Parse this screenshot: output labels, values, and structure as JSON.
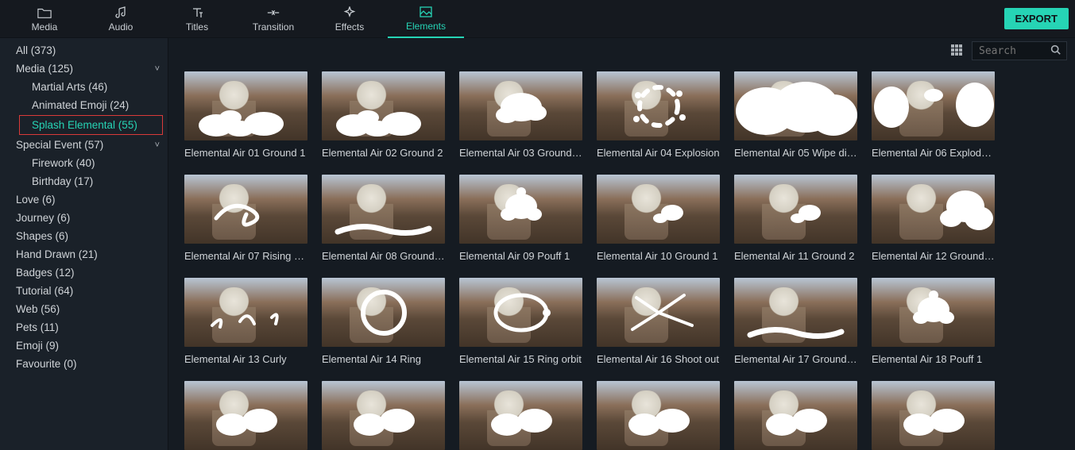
{
  "topbar": {
    "tabs": [
      {
        "label": "Media",
        "icon": "folder"
      },
      {
        "label": "Audio",
        "icon": "music"
      },
      {
        "label": "Titles",
        "icon": "text"
      },
      {
        "label": "Transition",
        "icon": "transition"
      },
      {
        "label": "Effects",
        "icon": "sparkle"
      },
      {
        "label": "Elements",
        "icon": "image",
        "active": true
      }
    ],
    "export_label": "EXPORT"
  },
  "sidebar": {
    "items": [
      {
        "label": "All (373)",
        "indent": 0
      },
      {
        "label": "Media (125)",
        "indent": 0,
        "expand": true
      },
      {
        "label": "Martial Arts (46)",
        "indent": 1
      },
      {
        "label": "Animated Emoji (24)",
        "indent": 1
      },
      {
        "label": "Splash Elemental (55)",
        "indent": 1,
        "selected": true
      },
      {
        "label": "Special Event (57)",
        "indent": 0,
        "expand": true
      },
      {
        "label": "Firework (40)",
        "indent": 1
      },
      {
        "label": "Birthday (17)",
        "indent": 1
      },
      {
        "label": "Love (6)",
        "indent": 0
      },
      {
        "label": "Journey (6)",
        "indent": 0
      },
      {
        "label": "Shapes (6)",
        "indent": 0
      },
      {
        "label": "Hand Drawn (21)",
        "indent": 0
      },
      {
        "label": "Badges (12)",
        "indent": 0
      },
      {
        "label": "Tutorial (64)",
        "indent": 0
      },
      {
        "label": "Web (56)",
        "indent": 0
      },
      {
        "label": "Pets (11)",
        "indent": 0
      },
      {
        "label": "Emoji (9)",
        "indent": 0
      },
      {
        "label": "Favourite (0)",
        "indent": 0
      }
    ]
  },
  "search": {
    "placeholder": "Search"
  },
  "grid": {
    "items": [
      {
        "label": "Elemental Air 01 Ground 1",
        "shape": "clouds-low"
      },
      {
        "label": "Elemental Air 02 Ground 2",
        "shape": "clouds-low"
      },
      {
        "label": "Elemental Air 03 Ground ...",
        "shape": "puff-center"
      },
      {
        "label": "Elemental Air 04 Explosion",
        "shape": "ring-burst"
      },
      {
        "label": "Elemental Air 05 Wipe dis...",
        "shape": "full-clouds"
      },
      {
        "label": "Elemental Air 06 Explode ...",
        "shape": "clouds-sides"
      },
      {
        "label": "Elemental Air 07 Rising st...",
        "shape": "swirl"
      },
      {
        "label": "Elemental Air 08 Ground ...",
        "shape": "low-stream"
      },
      {
        "label": "Elemental Air 09 Pouff 1",
        "shape": "pouff"
      },
      {
        "label": "Elemental Air 10 Ground 1",
        "shape": "small-puff"
      },
      {
        "label": "Elemental Air 11 Ground 2",
        "shape": "small-puff"
      },
      {
        "label": "Elemental Air 12 Ground ...",
        "shape": "clouds-right"
      },
      {
        "label": "Elemental Air 13 Curly",
        "shape": "curly"
      },
      {
        "label": "Elemental Air 14 Ring",
        "shape": "ring"
      },
      {
        "label": "Elemental Air 15 Ring orbit",
        "shape": "ring-orbit"
      },
      {
        "label": "Elemental Air 16 Shoot out",
        "shape": "shoot"
      },
      {
        "label": "Elemental Air 17 Ground ...",
        "shape": "low-stream"
      },
      {
        "label": "Elemental Air 18 Pouff 1",
        "shape": "pouff"
      },
      {
        "label": "",
        "shape": "row4"
      },
      {
        "label": "",
        "shape": "row4"
      },
      {
        "label": "",
        "shape": "row4"
      },
      {
        "label": "",
        "shape": "row4"
      },
      {
        "label": "",
        "shape": "row4"
      },
      {
        "label": "",
        "shape": "row4"
      }
    ]
  }
}
